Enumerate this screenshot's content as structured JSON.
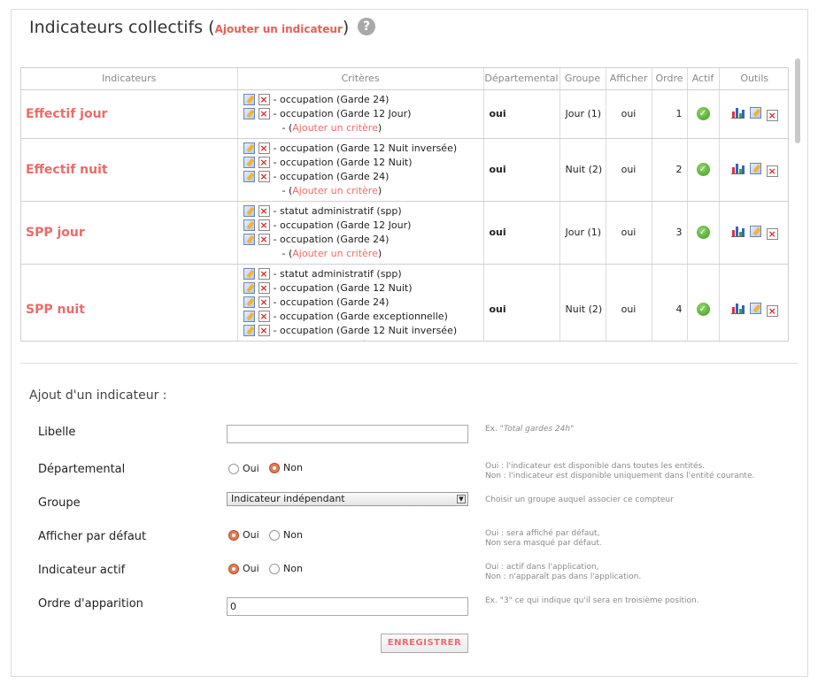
{
  "header": {
    "title": "Indicateurs collectifs",
    "paren_open": "(",
    "add_link": "Ajouter un indicateur",
    "paren_close": ")",
    "help_icon_glyph": "?"
  },
  "table": {
    "columns": [
      "Indicateurs",
      "Critères",
      "Départemental",
      "Groupe",
      "Afficher",
      "Ordre",
      "Actif",
      "Outils"
    ],
    "add_criterion_prefix": "- (",
    "add_criterion_label": "Ajouter un critère",
    "add_criterion_suffix": ")",
    "rows": [
      {
        "name": "Effectif jour",
        "criteria": [
          "- occupation (Garde 24)",
          "- occupation (Garde 12 Jour)"
        ],
        "departemental": "oui",
        "groupe": "Jour (1)",
        "afficher": "oui",
        "ordre": "1"
      },
      {
        "name": "Effectif nuit",
        "criteria": [
          "- occupation (Garde 12 Nuit inversée)",
          "- occupation (Garde 12 Nuit)",
          "- occupation (Garde 24)"
        ],
        "departemental": "oui",
        "groupe": "Nuit (2)",
        "afficher": "oui",
        "ordre": "2"
      },
      {
        "name": "SPP jour",
        "criteria": [
          "- statut administratif (spp)",
          "- occupation (Garde 12 Jour)",
          "- occupation (Garde 24)"
        ],
        "departemental": "oui",
        "groupe": "Jour (1)",
        "afficher": "oui",
        "ordre": "3"
      },
      {
        "name": "SPP nuit",
        "criteria": [
          "- statut administratif (spp)",
          "- occupation (Garde 12 Nuit)",
          "- occupation (Garde 24)",
          "- occupation (Garde exceptionnelle)",
          "- occupation (Garde 12 Nuit inversée)"
        ],
        "departemental": "oui",
        "groupe": "Nuit (2)",
        "afficher": "oui",
        "ordre": "4"
      }
    ]
  },
  "form": {
    "title": "Ajout d'un indicateur :",
    "libelle_label": "Libelle",
    "libelle_value": "",
    "libelle_hint_prefix": "Ex. \"",
    "libelle_hint_example": "Total gardes 24h",
    "libelle_hint_suffix": "\"",
    "dept_label": "Départemental",
    "dept_hint_1": "Oui : l'indicateur est disponible dans toutes les entités.",
    "dept_hint_2": "Non : l'indicateur est disponible uniquement dans l'entité courante.",
    "groupe_label": "Groupe",
    "groupe_selected": "Indicateur indépendant",
    "groupe_hint": "Choisir un groupe auquel associer ce compteur",
    "afficher_label": "Afficher par défaut",
    "afficher_hint_1": "Oui : sera affiché par défaut,",
    "afficher_hint_2": "Non sera masqué par défaut.",
    "actif_label": "Indicateur actif",
    "actif_hint_1": "Oui : actif dans l'application,",
    "actif_hint_2": "Non : n'apparaît pas dans l'application.",
    "ordre_label": "Ordre d'apparition",
    "ordre_value": "0",
    "ordre_hint": "Ex. \"3\" ce qui indique qu'il sera en troisième position.",
    "oui": "Oui",
    "non": "Non",
    "save_label": "ENREGISTRER"
  },
  "colors": {
    "accent": "#ec6b68",
    "check": "#3c9b1f",
    "radio_on": "#e77a4f"
  }
}
